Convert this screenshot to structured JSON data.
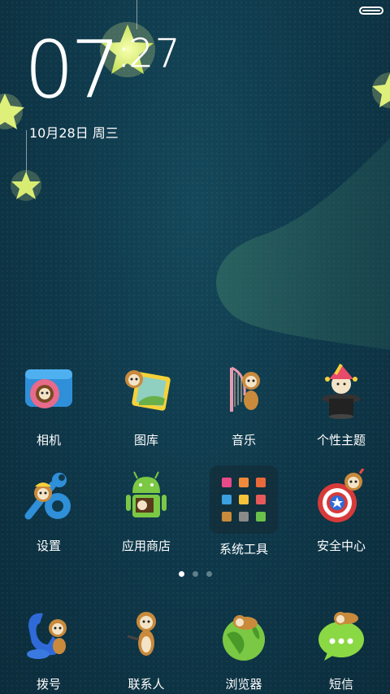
{
  "status": {
    "battery_icon": "battery-icon"
  },
  "lockscreen": {
    "hour": "07",
    "minute": "27",
    "date": "10月28日 周三"
  },
  "apps_row1": [
    {
      "label": "相机",
      "icon": "camera-icon"
    },
    {
      "label": "图库",
      "icon": "gallery-icon"
    },
    {
      "label": "音乐",
      "icon": "music-icon"
    },
    {
      "label": "个性主题",
      "icon": "themes-icon"
    }
  ],
  "apps_row2": [
    {
      "label": "设置",
      "icon": "settings-icon"
    },
    {
      "label": "应用商店",
      "icon": "app-store-icon"
    },
    {
      "label": "系统工具",
      "icon": "system-tools-folder-icon"
    },
    {
      "label": "安全中心",
      "icon": "security-center-icon"
    }
  ],
  "dock": [
    {
      "label": "拨号",
      "icon": "phone-icon"
    },
    {
      "label": "联系人",
      "icon": "contacts-icon"
    },
    {
      "label": "浏览器",
      "icon": "browser-icon"
    },
    {
      "label": "短信",
      "icon": "messages-icon"
    }
  ],
  "pager": {
    "pages": 3,
    "active": 1
  },
  "colors": {
    "bg": "#0f3a4c",
    "wave": "#2e6a64",
    "star": "#e6f58a"
  }
}
